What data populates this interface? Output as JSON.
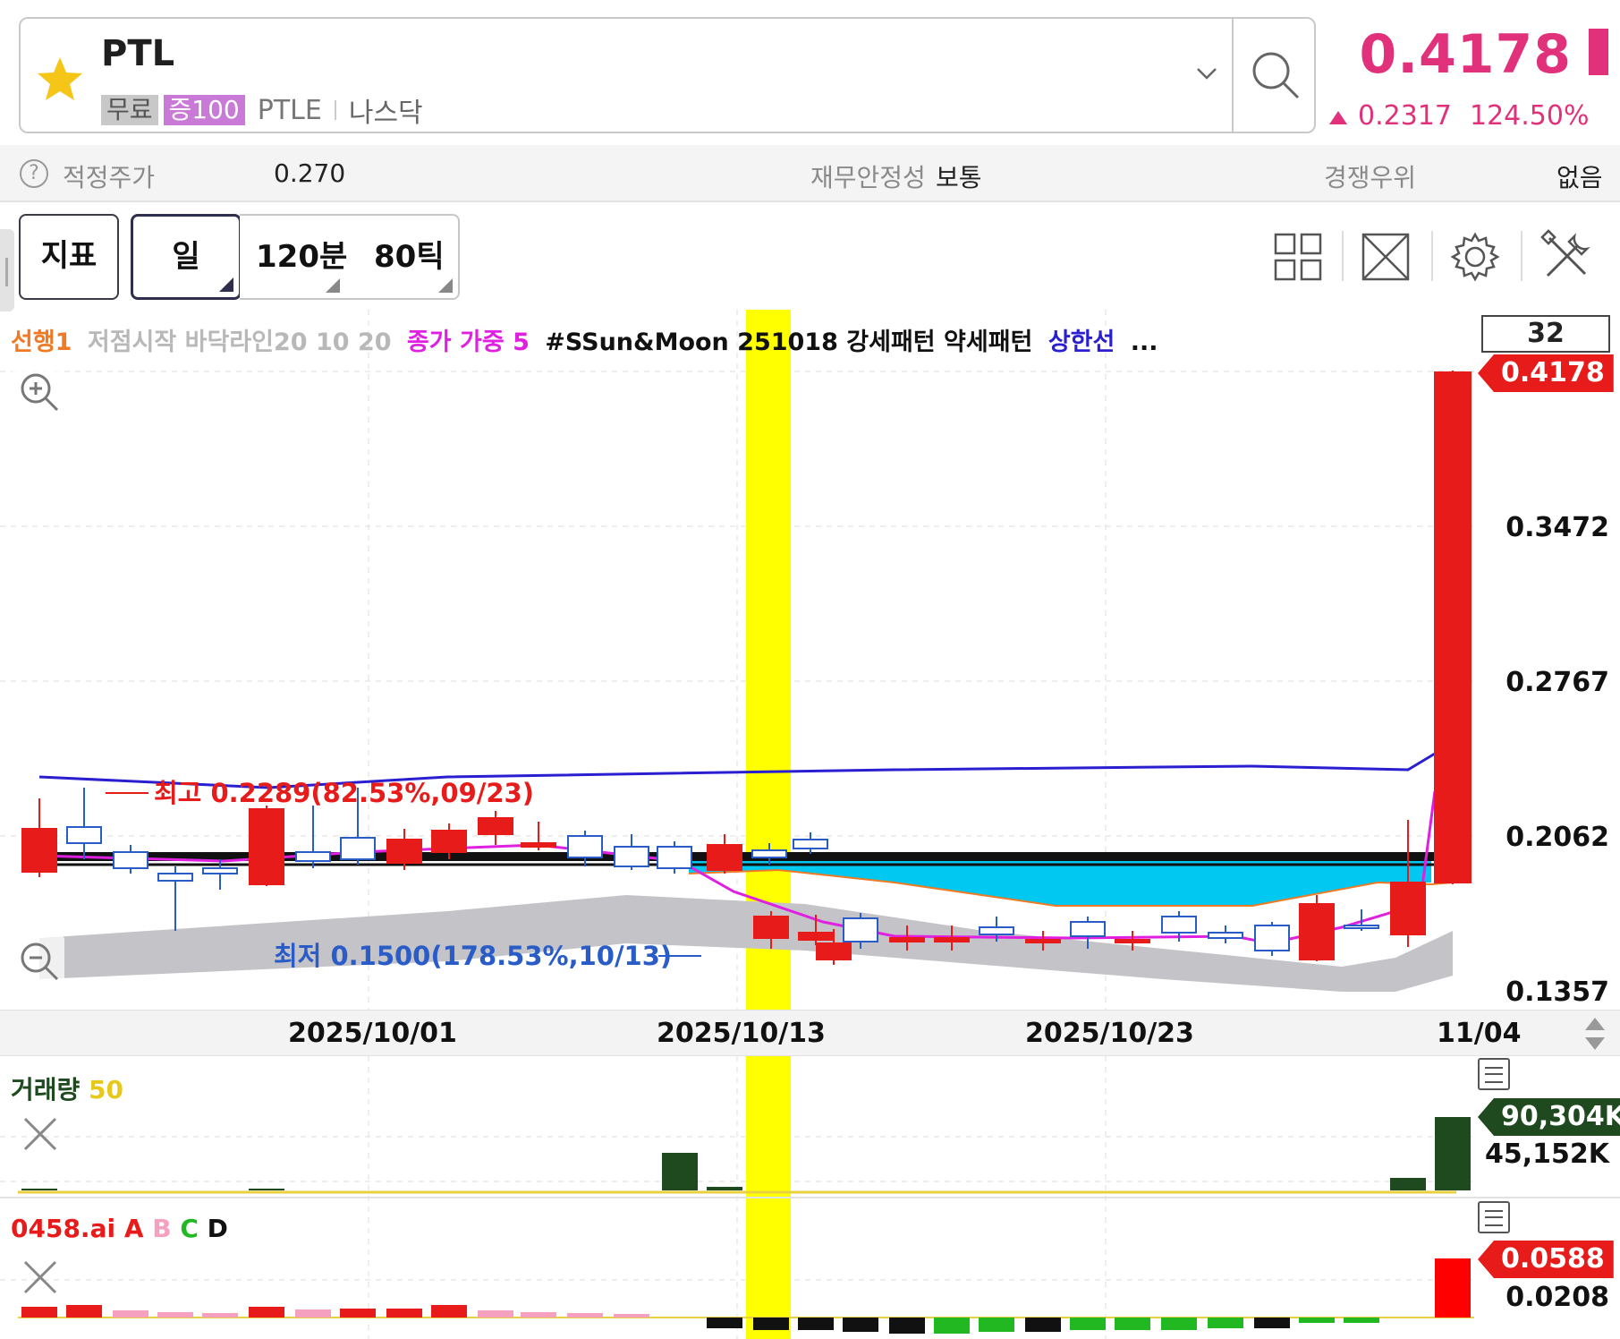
{
  "header": {
    "ticker": "PTL",
    "tag_free": "무료",
    "tag_margin": "증100",
    "code": "PTLE",
    "market": "나스닥",
    "price": "0.4178",
    "change": "0.2317",
    "change_pct": "124.50%"
  },
  "info": {
    "fair_price_label": "적정주가",
    "fair_price_value": "0.270",
    "stability_label": "재무안정성",
    "stability_value": "보통",
    "competitive_label": "경쟁우위",
    "competitive_value": "없음"
  },
  "toolbar": {
    "indicator_label": "지표",
    "day_label": "일",
    "min_label": "120분",
    "tick_label": "80틱"
  },
  "legend": {
    "item1": "선행1",
    "item2": "저점시작 바닥라인20 10 20",
    "item3": "종가 가중 5",
    "item4": "#SSun&Moon 251018 강세패턴 약세패턴",
    "item5": "상한선",
    "more": "..."
  },
  "chart": {
    "count": "32",
    "current_price_tag": "0.4178",
    "y_ticks": [
      "0.3472",
      "0.2767",
      "0.2062",
      "0.1357"
    ],
    "x_ticks": [
      "2025/10/01",
      "2025/10/13",
      "2025/10/23",
      "11/04"
    ],
    "high_annotation": "최고 0.2289(82.53%,09/23)",
    "low_annotation": "최저 0.1500(178.53%,10/13)"
  },
  "volume": {
    "title": "거래량",
    "period": "50",
    "tag": "90,304K",
    "mid": "45,152K"
  },
  "ai": {
    "title": "0458.ai",
    "a": "A",
    "b": "B",
    "c": "C",
    "d": "D",
    "tag": "0.0588",
    "mid": "0.0208"
  },
  "colors": {
    "up": "#e81b1b",
    "down": "#2a5cc8",
    "accent": "#e0317a",
    "highlight": "#ffff00",
    "upper_band": "#2a1fd0",
    "ma": "#e020e0",
    "cloud": "#00c8f0",
    "volume_bar": "#1f4a1f"
  }
}
